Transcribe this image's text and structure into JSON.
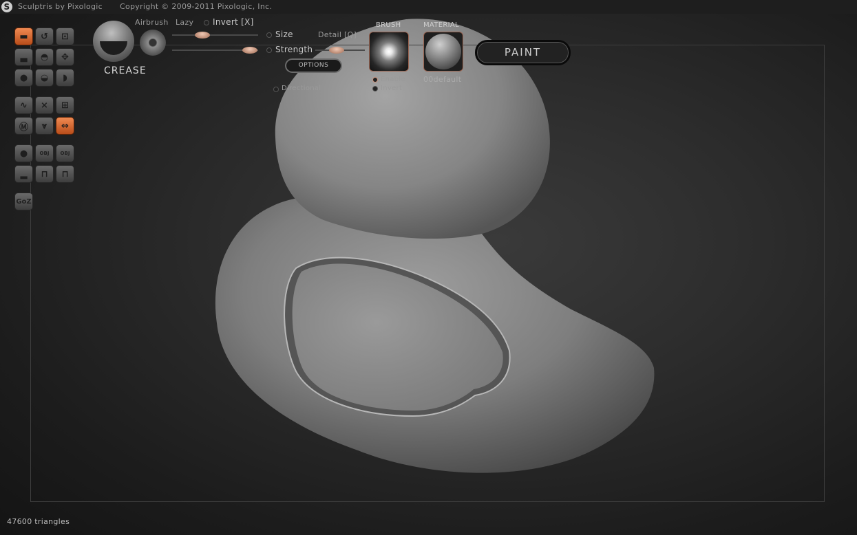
{
  "titlebar": {
    "app_title": "Sculptris by Pixologic",
    "copyright": "Copyright © 2009-2011 Pixologic, Inc."
  },
  "toolbar": {
    "tools": [
      {
        "name": "draw",
        "icon": "draw-brush-icon",
        "glyph": "▬",
        "active": true
      },
      {
        "name": "rotate",
        "icon": "rotate-brush-icon",
        "glyph": "↺",
        "active": false
      },
      {
        "name": "scale",
        "icon": "scale-brush-icon",
        "glyph": "⊡",
        "active": false
      },
      {
        "name": "flatten",
        "icon": "flatten-brush-icon",
        "glyph": "▃",
        "active": false
      },
      {
        "name": "inflate",
        "icon": "inflate-brush-icon",
        "glyph": "◓",
        "active": false
      },
      {
        "name": "grab",
        "icon": "grab-brush-icon",
        "glyph": "✥",
        "active": false
      },
      {
        "name": "pinch",
        "icon": "pinch-brush-icon",
        "glyph": "●",
        "active": false
      },
      {
        "name": "crease",
        "icon": "crease-brush-icon",
        "glyph": "◒",
        "active": false
      },
      {
        "name": "smooth",
        "icon": "smooth-brush-icon",
        "glyph": "◗",
        "active": false
      },
      {
        "name": "reduce-brush",
        "icon": "reduce-brush-icon",
        "glyph": "∿",
        "active": false
      },
      {
        "name": "reduce-selected",
        "icon": "reduce-selected-icon",
        "glyph": "⨯",
        "active": false
      },
      {
        "name": "subdivide-all",
        "icon": "subdivide-all-icon",
        "glyph": "⊞",
        "active": false
      },
      {
        "name": "mask",
        "icon": "mask-icon",
        "glyph": "Ⓜ",
        "active": false
      },
      {
        "name": "wireframe",
        "icon": "wireframe-icon",
        "glyph": "⩔",
        "active": false
      },
      {
        "name": "symmetry",
        "icon": "symmetry-icon",
        "glyph": "⇔",
        "active": true
      },
      {
        "name": "new-sphere",
        "icon": "new-sphere-icon",
        "glyph": "●",
        "active": false
      },
      {
        "name": "import-obj",
        "icon": "import-obj-icon",
        "glyph": "OBJ",
        "active": false
      },
      {
        "name": "export-obj",
        "icon": "export-obj-icon",
        "glyph": "OBJ",
        "active": false
      },
      {
        "name": "new-plane",
        "icon": "new-plane-icon",
        "glyph": "▂",
        "active": false
      },
      {
        "name": "open-file",
        "icon": "open-file-icon",
        "glyph": "⊓",
        "active": false
      },
      {
        "name": "save-file",
        "icon": "save-file-icon",
        "glyph": "⊓",
        "active": false
      },
      {
        "name": "goz",
        "icon": "goz-icon",
        "glyph": "GoZ",
        "active": false
      }
    ]
  },
  "brush_panel": {
    "current_tool": "CREASE",
    "airbrush_label": "Airbrush",
    "lazy_label": "Lazy",
    "invert_label": "Invert [X]",
    "size_label": "Size",
    "strength_label": "Strength",
    "detail_label": "Detail [Q]",
    "options_label": "OPTIONS",
    "directional_label": "Directional",
    "brush_title": "BRUSH",
    "enable_label": "Enable",
    "brush_invert_label": "Invert",
    "material_title": "MATERIAL",
    "material_name": "00default",
    "paint_label": "PAINT"
  },
  "status": {
    "triangles": "47600 triangles"
  }
}
